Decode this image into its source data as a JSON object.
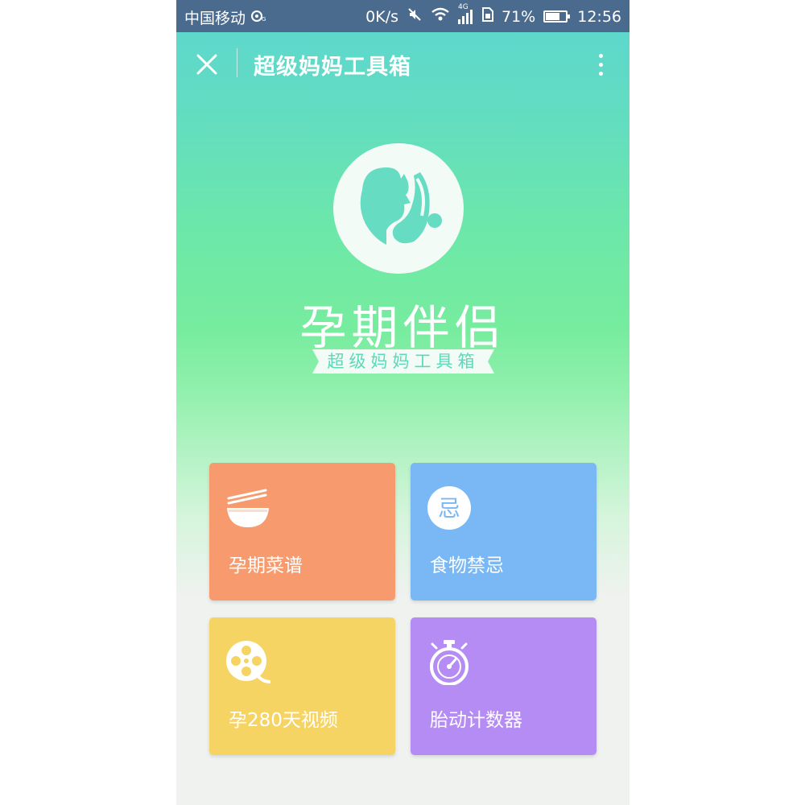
{
  "status_bar": {
    "carrier": "中国移动",
    "speed": "0K/s",
    "network": "4G",
    "battery_percent": "71%",
    "battery_level": 0.71,
    "time": "12:56"
  },
  "title_bar": {
    "title": "超级妈妈工具箱"
  },
  "hero": {
    "brand_name": "孕期伴侣",
    "ribbon_text": "超级妈妈工具箱"
  },
  "tools": [
    {
      "label": "孕期菜谱",
      "icon": "bowl-chopsticks-icon",
      "color": "#f79a6e"
    },
    {
      "label": "食物禁忌",
      "icon": "taboo-badge-icon",
      "icon_text": "忌",
      "color": "#7ab8f5"
    },
    {
      "label": "孕280天视频",
      "icon": "film-reel-icon",
      "color": "#f6d463"
    },
    {
      "label": "胎动计数器",
      "icon": "stopwatch-icon",
      "color": "#b58cf3"
    }
  ],
  "colors": {
    "status_bar": "#4b6b8e",
    "hero_top": "#5cd6d0",
    "hero_mid": "#76ec9e",
    "page_bg": "#eff2ef"
  }
}
